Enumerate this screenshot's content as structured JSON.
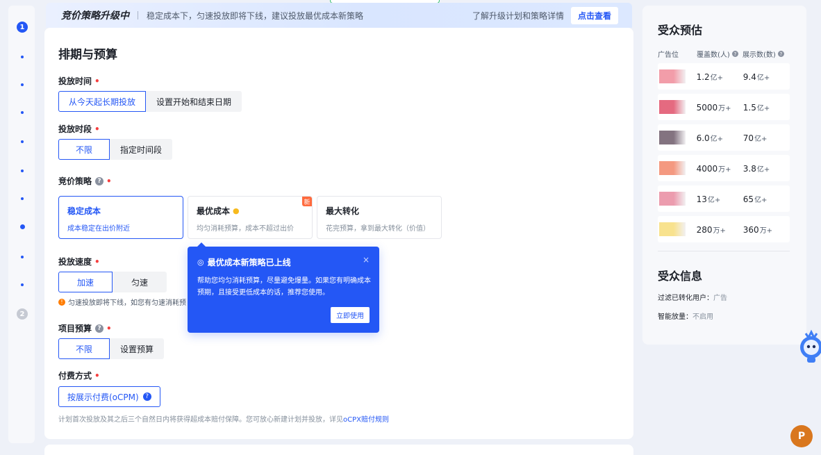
{
  "steps": {
    "first": "1",
    "second": "2"
  },
  "banner": {
    "title": "竞价策略升级中",
    "desc": "稳定成本下，匀速投放即将下线，建议投放最优成本新策略",
    "link_text": "了解升级计划和策略详情",
    "button": "点击查看"
  },
  "main": {
    "title": "排期与预算",
    "delivery_time": {
      "label": "投放时间",
      "options": [
        "从今天起长期投放",
        "设置开始和结束日期"
      ],
      "selected": 0
    },
    "delivery_period": {
      "label": "投放时段",
      "options": [
        "不限",
        "指定时间段"
      ],
      "selected": 0
    },
    "bid_strategy": {
      "label": "竞价策略",
      "cards": [
        {
          "title": "稳定成本",
          "desc": "成本稳定在出价附近"
        },
        {
          "title": "最优成本",
          "desc": "均匀消耗预算，成本不超过出价",
          "badge": "新"
        },
        {
          "title": "最大转化",
          "desc": "花完预算，拿到最大转化（价值）"
        }
      ]
    },
    "delivery_speed": {
      "label": "投放速度",
      "options": [
        "加速",
        "匀速"
      ],
      "selected": 0,
      "warning": "匀速投放即将下线，如您有匀速消耗预"
    },
    "budget": {
      "label": "项目预算",
      "options": [
        "不限",
        "设置预算"
      ],
      "selected": 0
    },
    "payment": {
      "label": "付费方式",
      "button": "按展示付费(oCPM)",
      "note": "计划首次投放及其之后三个自然日内将获得超成本赔付保障。您可放心新建计划并投放，详见",
      "note_link": "oCPX赔付规则"
    }
  },
  "popover": {
    "title": "最优成本新策略已上线",
    "body": "帮助您均匀消耗预算，尽量避免爆量。如果您有明确成本预期，且接受更低成本的话，推荐您使用。",
    "close": "×",
    "button": "立即使用"
  },
  "audience": {
    "title": "受众预估",
    "headers": {
      "slot": "广告位",
      "coverage": "覆盖数(人)",
      "impressions": "展示数(数)"
    },
    "rows": [
      {
        "cov": "1.2",
        "cov_unit": "亿+",
        "imp": "9.4",
        "imp_unit": "亿+",
        "color": "#f08c9a"
      },
      {
        "cov": "5000",
        "cov_unit": "万+",
        "imp": "1.5",
        "imp_unit": "亿+",
        "color": "#e0506a"
      },
      {
        "cov": "6.0",
        "cov_unit": "亿+",
        "imp": "70",
        "imp_unit": "亿+",
        "color": "#6d5a6a"
      },
      {
        "cov": "4000",
        "cov_unit": "万+",
        "imp": "3.8",
        "imp_unit": "亿+",
        "color": "#f2876a"
      },
      {
        "cov": "13",
        "cov_unit": "亿+",
        "imp": "65",
        "imp_unit": "亿+",
        "color": "#e88aa0"
      },
      {
        "cov": "280",
        "cov_unit": "万+",
        "imp": "360",
        "imp_unit": "万+",
        "color": "#f7dd7a"
      }
    ]
  },
  "audience_info": {
    "title": "受众信息",
    "filter_label": "过滤已转化用户：",
    "filter_value": "广告",
    "smart_label": "智能放量：",
    "smart_value": "不启用"
  },
  "user": {
    "avatar_letter": "P"
  }
}
